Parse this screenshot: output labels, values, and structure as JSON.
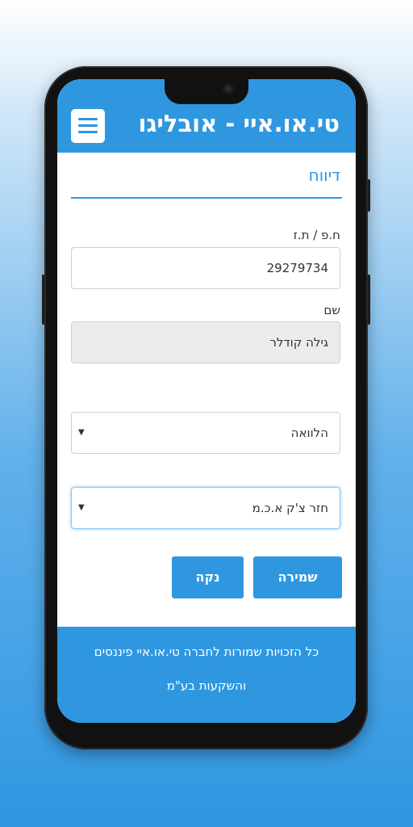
{
  "header": {
    "title": "טי.או.איי - אובליגו",
    "menu_icon": "hamburger-menu-icon"
  },
  "section": {
    "title": "דיווח"
  },
  "form": {
    "id_label": "ח.פ / ת.ז",
    "id_value": "29279734",
    "name_label": "שם",
    "name_value": "גילה קודלר",
    "type_select": "הלוואה",
    "subtype_select": "חזר צ'ק א.כ.מ",
    "select_icon": "dropdown-arrow-icon"
  },
  "actions": {
    "save_label": "שמירה",
    "clear_label": "נקה"
  },
  "footer": {
    "line1": "כל הזכויות שמורות לחברה טי.או.איי פיננסים",
    "line2": "והשקעות בע\"מ"
  },
  "colors": {
    "accent": "#2f97e0",
    "background_bottom": "#2f96e2"
  }
}
